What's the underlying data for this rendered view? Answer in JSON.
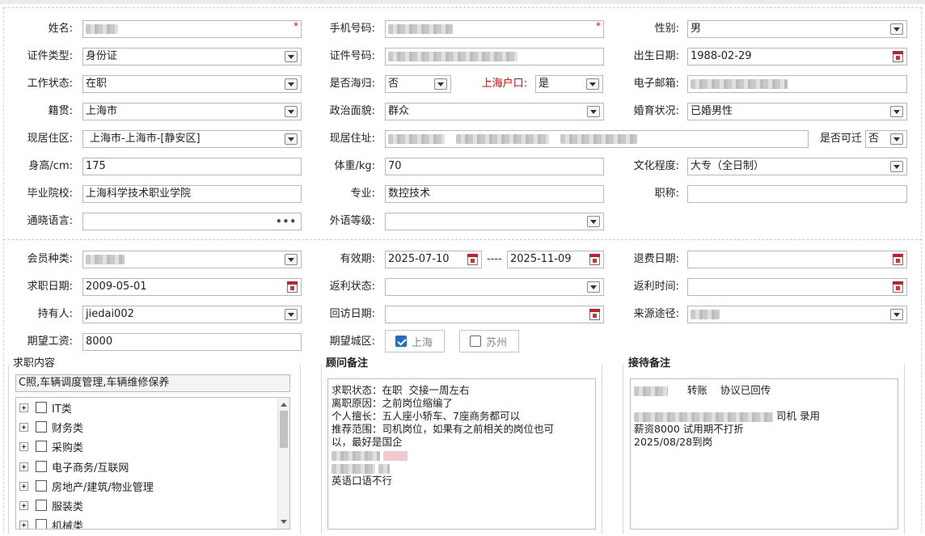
{
  "row1": {
    "name_label": "姓名:",
    "phone_label": "手机号码:",
    "gender_label": "性别:",
    "gender": "男",
    "required_mark": "*"
  },
  "row2": {
    "idtype_label": "证件类型:",
    "idtype": "身份证",
    "idno_label": "证件号码:",
    "birth_label": "出生日期:",
    "birth": "1988-02-29"
  },
  "row3": {
    "work_label": "工作状态:",
    "work": "在职",
    "overseas_label": "是否海归:",
    "overseas": "否",
    "hukou_label": "上海户口:",
    "hukou": "是",
    "email_label": "电子邮箱:"
  },
  "row4": {
    "native_label": "籍贯:",
    "native": "上海市",
    "political_label": "政治面貌:",
    "political": "群众",
    "marital_label": "婚育状况:",
    "marital": "已婚男性"
  },
  "row5": {
    "district_label": "现居住区:",
    "district": "上海市-上海市-[静安区]",
    "address_label": "现居住址:",
    "relocate_label": "是否可迁",
    "relocate": "否"
  },
  "row6": {
    "height_label": "身高/cm:",
    "height": "175",
    "weight_label": "体重/kg:",
    "weight": "70",
    "edu_label": "文化程度:",
    "edu": "大专（全日制）"
  },
  "row7": {
    "school_label": "毕业院校:",
    "school": "上海科学技术职业学院",
    "major_label": "专业:",
    "major": "数控技术",
    "title_label": "职称:"
  },
  "row8": {
    "lang_label": "通晓语言:",
    "lang_dots": "•••",
    "foreign_label": "外语等级:"
  },
  "row9": {
    "member_label": "会员种类:",
    "valid_label": "有效期:",
    "valid_from": "2025-07-10",
    "valid_sep": "----",
    "valid_to": "2025-11-09",
    "refund_label": "退费日期:"
  },
  "row10": {
    "jobdate_label": "求职日期:",
    "jobdate": "2009-05-01",
    "rebate_label": "返利状态:",
    "rebatetime_label": "返利时间:"
  },
  "row11": {
    "holder_label": "持有人:",
    "holder": "jiedai002",
    "visit_label": "回访日期:",
    "source_label": "来源途径:"
  },
  "row12": {
    "salary_label": "期望工资:",
    "salary": "8000",
    "city_label": "期望城区:",
    "city_options": [
      "上海",
      "苏州"
    ]
  },
  "job_content": {
    "title": "求职内容",
    "summary": "C照,车辆调度管理,车辆维修保养",
    "tree": [
      "IT类",
      "财务类",
      "采购类",
      "电子商务/互联网",
      "房地产/建筑/物业管理",
      "服装类",
      "机械类"
    ]
  },
  "consultant": {
    "title": "顾问备注",
    "lines": [
      "求职状态：在职  交接一周左右",
      "离职原因：之前岗位缩编了",
      "个人擅长：五人座小轿车、7座商务都可以",
      "推荐范围：司机岗位，如果有之前相关的岗位也可",
      "以，最好是国企",
      "英语口语不行"
    ]
  },
  "reception": {
    "title": "接待备注",
    "line1_a": "转账",
    "line1_b": "协议已回传",
    "line2": "司机 录用",
    "line3": "薪资8000 试用期不打折",
    "line4": "2025/08/28到岗"
  }
}
